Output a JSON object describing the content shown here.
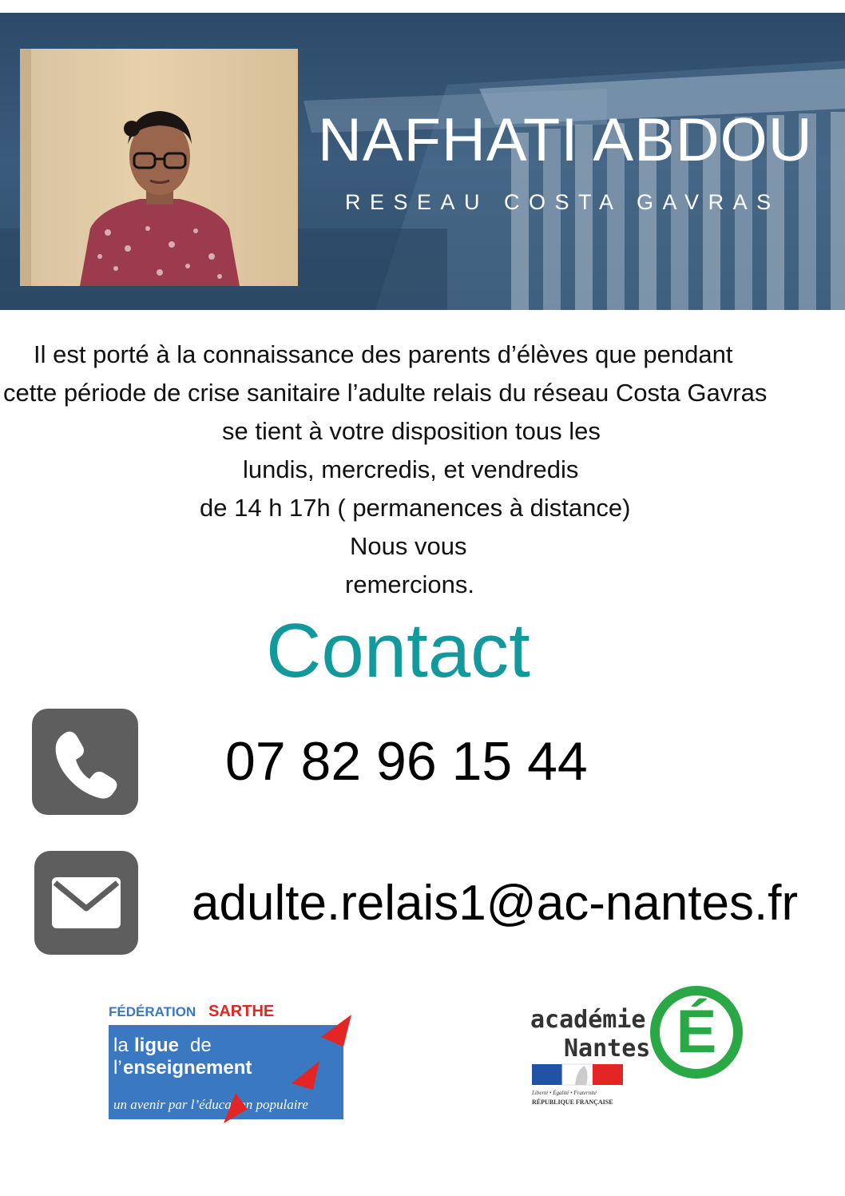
{
  "header": {
    "name": "NAFHATI ABDOU",
    "subtitle": "RESEAU COSTA GAVRAS"
  },
  "message": {
    "lines": [
      "Il est porté à la connaissance des parents d’élèves que pendant",
      "cette période de crise sanitaire l’adulte relais du réseau Costa Gavras",
      "se tient à votre disposition tous les",
      "lundis,  mercredis, et vendredis",
      "de 14 h 17h ( permanences à distance)",
      "Nous vous",
      "remercions."
    ]
  },
  "contact": {
    "title": "Contact",
    "phone": "07 82 96 15 44",
    "email": "adulte.relais1@ac-nantes.fr",
    "phone_icon": "phone-icon",
    "mail_icon": "envelope-icon"
  },
  "logos": {
    "ligue": {
      "federation": "FÉDÉRATION",
      "region": "SARTHE",
      "line1a": "la",
      "line1b": "ligue",
      "line1c": "de",
      "line2a": "l’",
      "line2b": "enseignement",
      "tagline": "un avenir par l’éducation populaire"
    },
    "academie": {
      "line1": "académie",
      "line2": "Nantes",
      "letter": "É",
      "motto": "Liberté • Égalité • Fraternité",
      "republic": "RÉPUBLIQUE FRANÇAISE"
    }
  },
  "colors": {
    "banner": "#2f4e6c",
    "contact_title": "#12999c",
    "icon_box": "#5e5e5e",
    "ligue_blue": "#3a78c2",
    "ligue_red": "#e32526",
    "academie_green": "#2aa845"
  }
}
